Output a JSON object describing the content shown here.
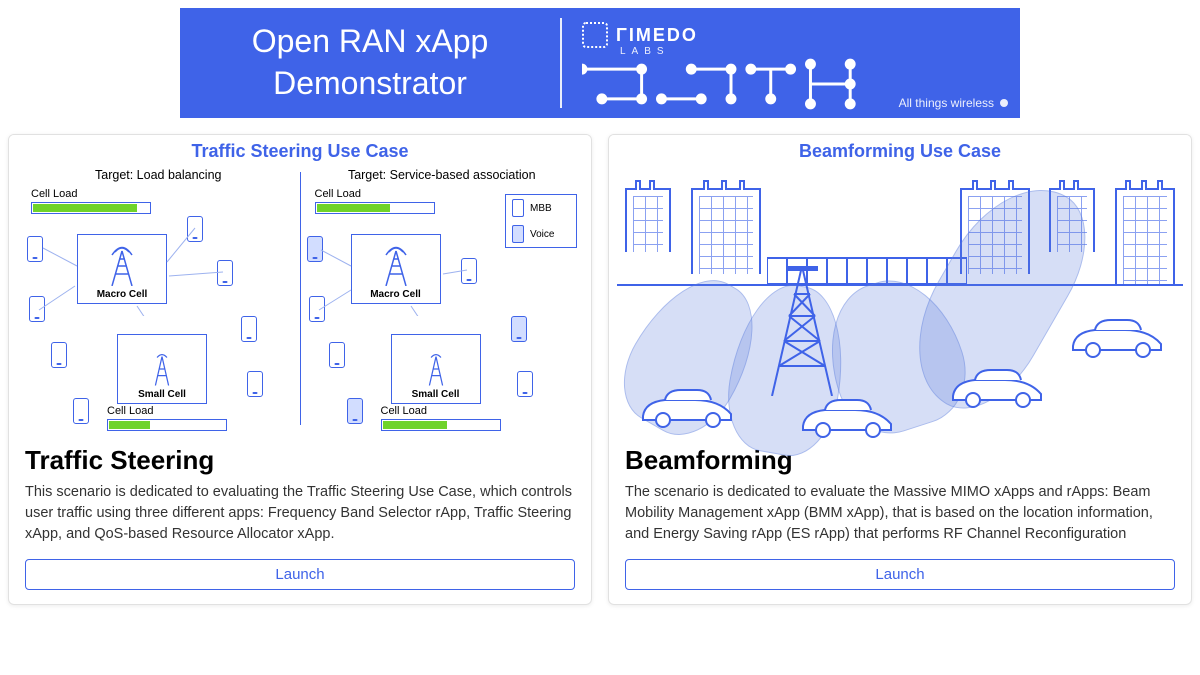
{
  "banner": {
    "title_line1": "Open RAN xApp",
    "title_line2": "Demonstrator",
    "logo_text": "ΓIMEDO",
    "logo_sub": "LABS",
    "tagline": "All things wireless"
  },
  "cards": {
    "traffic": {
      "fig_title": "Traffic Steering Use Case",
      "target_left": "Target: Load balancing",
      "target_right": "Target: Service-based association",
      "cell_load_label": "Cell Load",
      "macro_label": "Macro Cell",
      "small_label": "Small Cell",
      "legend_mbb": "MBB",
      "legend_voice": "Voice",
      "title": "Traffic Steering",
      "desc": "This scenario is dedicated to evaluating the Traffic Steering Use Case, which controls user traffic using three different apps: Frequency Band Selector rApp, Traffic Steering xApp, and QoS-based Resource Allocator xApp.",
      "launch": "Launch"
    },
    "beam": {
      "fig_title": "Beamforming Use Case",
      "title": "Beamforming",
      "desc": "The scenario is dedicated to evaluate the Massive MIMO xApps and rApps: Beam Mobility Management xApp (BMM xApp), that is based on the location information, and Energy Saving rApp (ES rApp) that performs RF Channel Reconfiguration",
      "launch": "Launch"
    }
  }
}
